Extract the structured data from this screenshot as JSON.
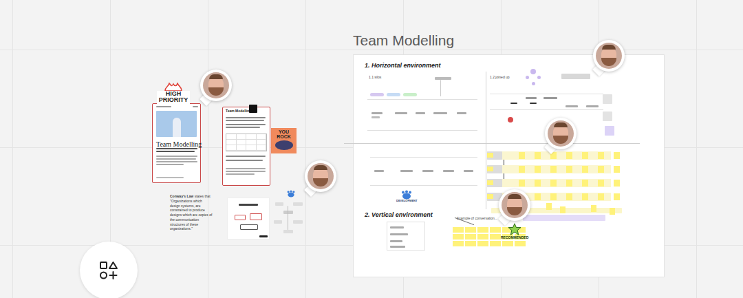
{
  "canvas": {
    "title": "Team Modelling"
  },
  "frame": {
    "sections": [
      {
        "title": "1. Horizontal environment",
        "quadrants": [
          "1.1 silos",
          "1.2 joined up"
        ]
      },
      {
        "title": "2. Vertical environment",
        "note": "Example of conversation..."
      }
    ]
  },
  "cards": [
    {
      "title": "Team Modelling",
      "kind": "poster"
    },
    {
      "title": "Team Modelling",
      "kind": "checklist"
    }
  ],
  "stickers": {
    "priority": "HIGH PRIORITY",
    "praise": "YOU ROCK",
    "recommended": "RECOMMENDED",
    "development": "DEVELOPMENT"
  },
  "note": {
    "bold": "Conway's Law",
    "rest": " states that \"Organizations which design systems, are constrained to produce designs which are copies of the communication structures of these organizations.\""
  }
}
